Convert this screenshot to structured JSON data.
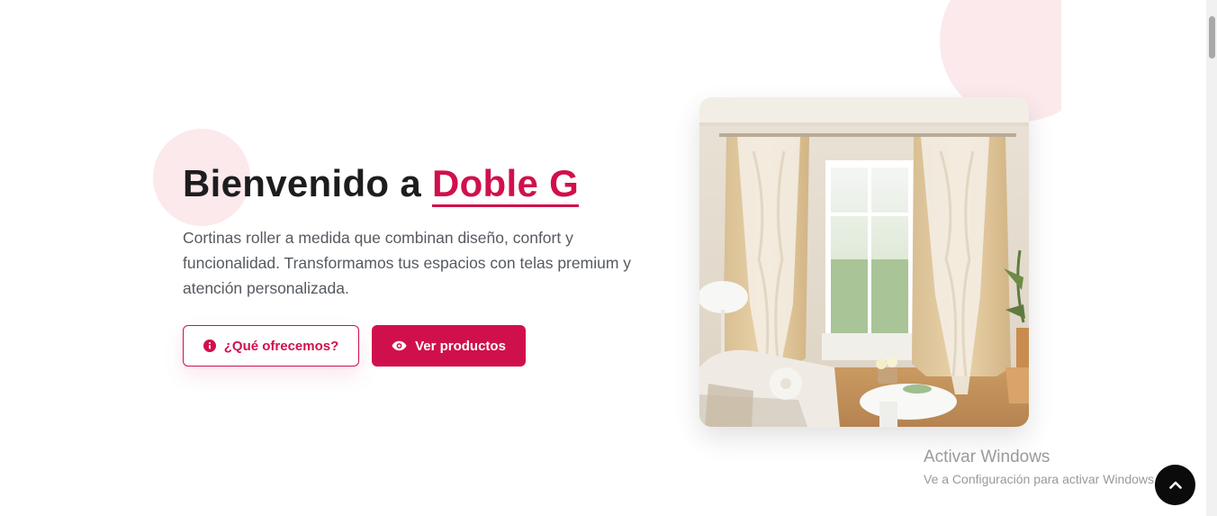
{
  "hero": {
    "title_prefix": "Bienvenido a ",
    "brand": "Doble G",
    "description": "Cortinas roller a medida que combinan diseño, confort y funcionalidad. Transformamos tus espacios con telas premium y atención personalizada.",
    "buttons": {
      "offer_label": "¿Qué ofrecemos?",
      "offer_icon": "info-circle-icon",
      "products_label": "Ver productos",
      "products_icon": "eye-icon"
    },
    "image_alt": "living room with beige curtains"
  },
  "windows_watermark": {
    "title": "Activar Windows",
    "subtitle": "Ve a Configuración para activar Windows."
  },
  "back_to_top_icon": "chevron-up-icon",
  "colors": {
    "accent": "#d0104c",
    "accent_light": "#fbe9ec",
    "text_dark": "#1d1d1f",
    "text_muted": "#555a60"
  }
}
